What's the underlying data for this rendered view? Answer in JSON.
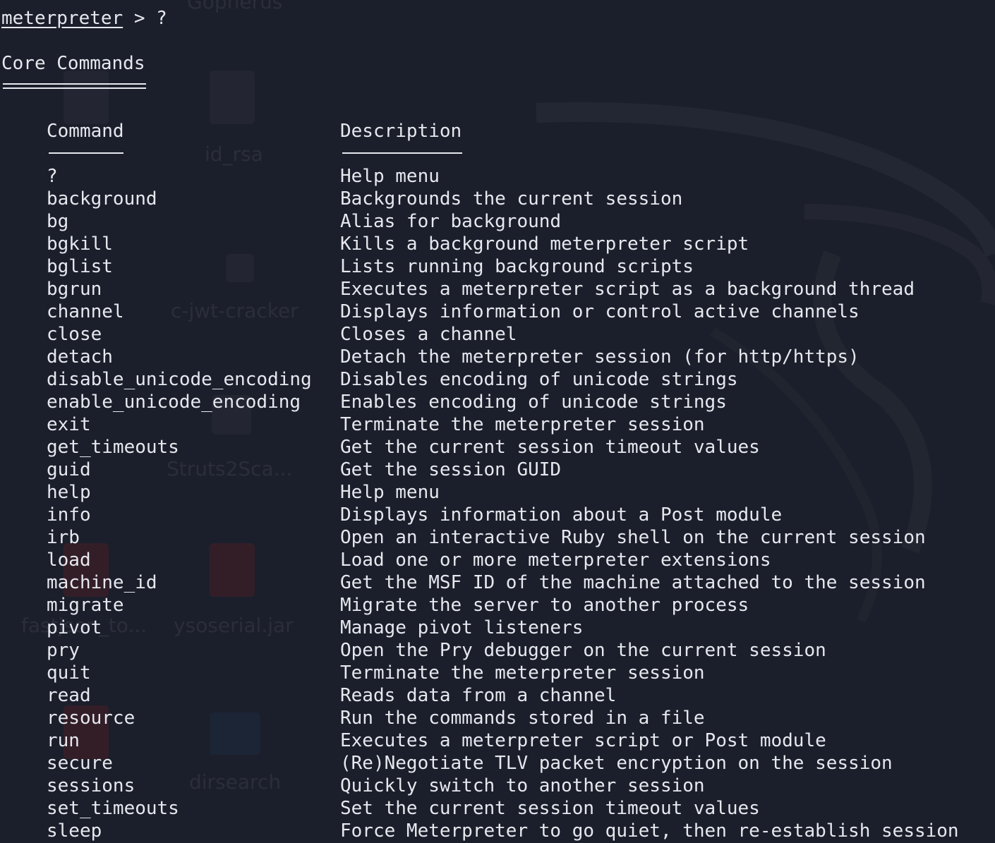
{
  "terminal": {
    "prompt": "meterpreter",
    "prompt_rest": " > ?",
    "section_title": "Core Commands",
    "col_command": "Command",
    "col_description": "Description",
    "fg_color": "#e6e8ee",
    "bg_color": "#1b1f2b"
  },
  "commands": [
    {
      "command": "?",
      "description": "Help menu"
    },
    {
      "command": "background",
      "description": "Backgrounds the current session"
    },
    {
      "command": "bg",
      "description": "Alias for background"
    },
    {
      "command": "bgkill",
      "description": "Kills a background meterpreter script"
    },
    {
      "command": "bglist",
      "description": "Lists running background scripts"
    },
    {
      "command": "bgrun",
      "description": "Executes a meterpreter script as a background thread"
    },
    {
      "command": "channel",
      "description": "Displays information or control active channels"
    },
    {
      "command": "close",
      "description": "Closes a channel"
    },
    {
      "command": "detach",
      "description": "Detach the meterpreter session (for http/https)"
    },
    {
      "command": "disable_unicode_encoding",
      "description": "Disables encoding of unicode strings"
    },
    {
      "command": "enable_unicode_encoding",
      "description": "Enables encoding of unicode strings"
    },
    {
      "command": "exit",
      "description": "Terminate the meterpreter session"
    },
    {
      "command": "get_timeouts",
      "description": "Get the current session timeout values"
    },
    {
      "command": "guid",
      "description": "Get the session GUID"
    },
    {
      "command": "help",
      "description": "Help menu"
    },
    {
      "command": "info",
      "description": "Displays information about a Post module"
    },
    {
      "command": "irb",
      "description": "Open an interactive Ruby shell on the current session"
    },
    {
      "command": "load",
      "description": "Load one or more meterpreter extensions"
    },
    {
      "command": "machine_id",
      "description": "Get the MSF ID of the machine attached to the session"
    },
    {
      "command": "migrate",
      "description": "Migrate the server to another process"
    },
    {
      "command": "pivot",
      "description": "Manage pivot listeners"
    },
    {
      "command": "pry",
      "description": "Open the Pry debugger on the current session"
    },
    {
      "command": "quit",
      "description": "Terminate the meterpreter session"
    },
    {
      "command": "read",
      "description": "Reads data from a channel"
    },
    {
      "command": "resource",
      "description": "Run the commands stored in a file"
    },
    {
      "command": "run",
      "description": "Executes a meterpreter script or Post module"
    },
    {
      "command": "secure",
      "description": "(Re)Negotiate TLV packet encryption on the session"
    },
    {
      "command": "sessions",
      "description": "Quickly switch to another session"
    },
    {
      "command": "set_timeouts",
      "description": "Set the current session timeout values"
    },
    {
      "command": "sleep",
      "description": "Force Meterpreter to go quiet, then re-establish session"
    }
  ],
  "desktop_background": {
    "labels": [
      "Gopherus",
      "id_rsa",
      "c-jwt-cracker",
      "Struts2Sca...",
      "ysoserial.jar",
      "dirsearch",
      "fastjson_to..."
    ]
  }
}
